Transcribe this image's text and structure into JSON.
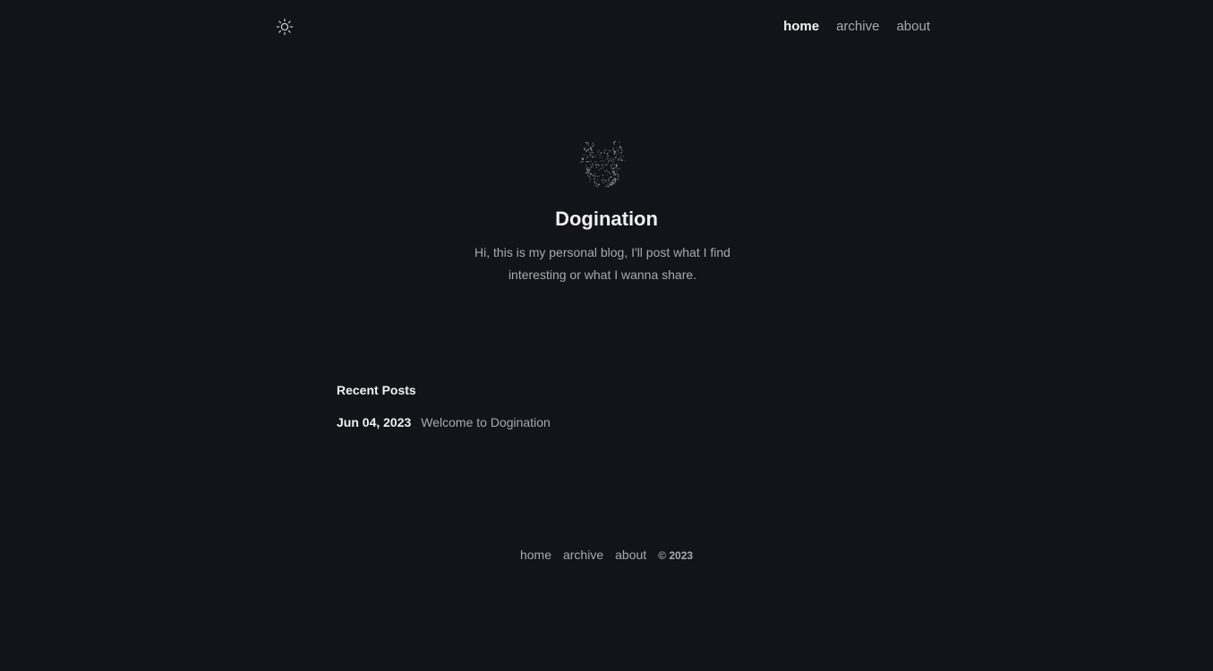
{
  "header": {
    "theme_toggle_icon": "sun-icon",
    "nav": [
      {
        "label": "home",
        "active": true
      },
      {
        "label": "archive",
        "active": false
      },
      {
        "label": "about",
        "active": false
      }
    ]
  },
  "hero": {
    "avatar_icon": "dog-avatar",
    "title": "Dogination",
    "description": "Hi, this is my personal blog, I'll post what I find interesting or what I wanna share."
  },
  "recent_posts": {
    "heading": "Recent Posts",
    "items": [
      {
        "date": "Jun 04, 2023",
        "title": "Welcome to Dogination"
      }
    ]
  },
  "footer": {
    "links": [
      "home",
      "archive",
      "about"
    ],
    "copyright": "© 2023"
  },
  "colors": {
    "background": "#131419",
    "text_primary": "#f0f0f2",
    "text_secondary": "#a8a9ad"
  }
}
